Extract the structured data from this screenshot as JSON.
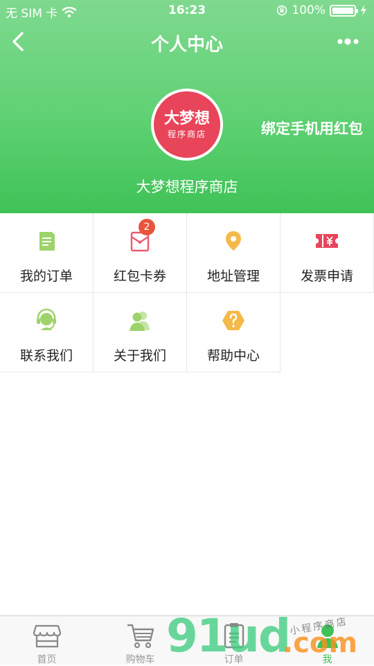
{
  "status_bar": {
    "carrier": "无 SIM 卡",
    "time": "16:23",
    "battery": "100%",
    "battery_level": 1.0
  },
  "nav": {
    "title": "个人中心",
    "back_icon": "chevron-left-icon",
    "more_icon": "more-dots-icon"
  },
  "profile": {
    "avatar_main": "大梦想",
    "avatar_sub": "程序商店",
    "store_name": "大梦想程序商店",
    "bind_phone": "绑定手机用红包"
  },
  "menu": [
    {
      "label": "我的订单",
      "icon": "order-icon",
      "color": "#9ed36a"
    },
    {
      "label": "红包卡券",
      "icon": "red-packet-icon",
      "color": "#ea5a6e",
      "badge": "2"
    },
    {
      "label": "地址管理",
      "icon": "location-pin-icon",
      "color": "#f5b94a"
    },
    {
      "label": "发票申请",
      "icon": "invoice-icon",
      "color": "#e8455a"
    },
    {
      "label": "联系我们",
      "icon": "headset-icon",
      "color": "#9ed36a"
    },
    {
      "label": "关于我们",
      "icon": "users-icon",
      "color": "#9ed36a"
    },
    {
      "label": "帮助中心",
      "icon": "help-icon",
      "color": "#f5b94a"
    }
  ],
  "tabbar": [
    {
      "label": "首页",
      "icon": "store-icon"
    },
    {
      "label": "购物车",
      "icon": "cart-icon"
    },
    {
      "label": "订单",
      "icon": "clipboard-icon"
    },
    {
      "label": "我",
      "icon": "user-icon",
      "active": true
    }
  ],
  "watermark": {
    "big": "91ud",
    "com": ".com",
    "small": "小程序商店"
  },
  "colors": {
    "accent": "#3fc257",
    "header_top": "#7fd98f",
    "header_bottom": "#3fc257",
    "badge": "#e8553d"
  }
}
